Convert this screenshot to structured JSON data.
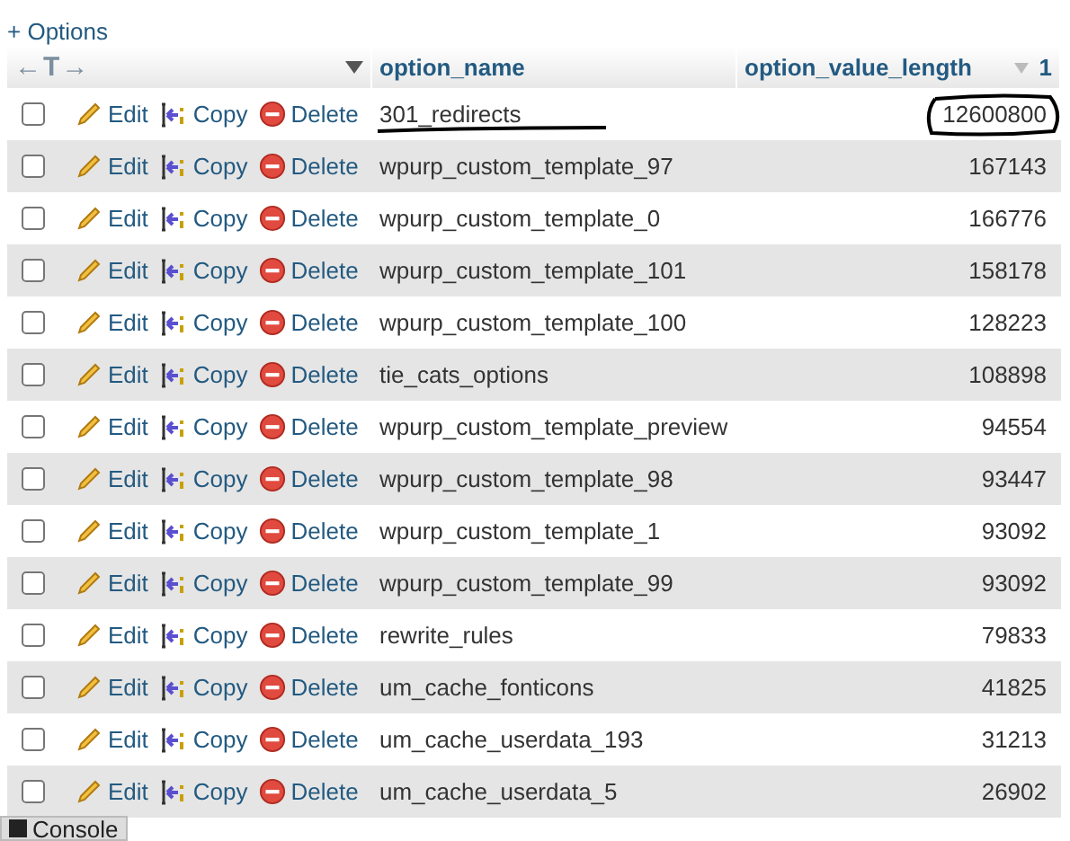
{
  "options_link": "+ Options",
  "header": {
    "arrows": "←T→",
    "columns": [
      {
        "label": "option_name"
      },
      {
        "label": "option_value_length",
        "sort_order": "1"
      }
    ]
  },
  "rows": [
    {
      "edit": "Edit",
      "copy": "Copy",
      "delete": "Delete",
      "name": "301_redirects",
      "length": "12600800",
      "checked": false,
      "marked": true
    },
    {
      "edit": "Edit",
      "copy": "Copy",
      "delete": "Delete",
      "name": "wpurp_custom_template_97",
      "length": "167143",
      "checked": false,
      "marked": false
    },
    {
      "edit": "Edit",
      "copy": "Copy",
      "delete": "Delete",
      "name": "wpurp_custom_template_0",
      "length": "166776",
      "checked": false,
      "marked": false
    },
    {
      "edit": "Edit",
      "copy": "Copy",
      "delete": "Delete",
      "name": "wpurp_custom_template_101",
      "length": "158178",
      "checked": false,
      "marked": false
    },
    {
      "edit": "Edit",
      "copy": "Copy",
      "delete": "Delete",
      "name": "wpurp_custom_template_100",
      "length": "128223",
      "checked": false,
      "marked": false
    },
    {
      "edit": "Edit",
      "copy": "Copy",
      "delete": "Delete",
      "name": "tie_cats_options",
      "length": "108898",
      "checked": false,
      "marked": false
    },
    {
      "edit": "Edit",
      "copy": "Copy",
      "delete": "Delete",
      "name": "wpurp_custom_template_preview",
      "length": "94554",
      "checked": false,
      "marked": false
    },
    {
      "edit": "Edit",
      "copy": "Copy",
      "delete": "Delete",
      "name": "wpurp_custom_template_98",
      "length": "93447",
      "checked": false,
      "marked": false
    },
    {
      "edit": "Edit",
      "copy": "Copy",
      "delete": "Delete",
      "name": "wpurp_custom_template_1",
      "length": "93092",
      "checked": false,
      "marked": false
    },
    {
      "edit": "Edit",
      "copy": "Copy",
      "delete": "Delete",
      "name": "wpurp_custom_template_99",
      "length": "93092",
      "checked": false,
      "marked": false
    },
    {
      "edit": "Edit",
      "copy": "Copy",
      "delete": "Delete",
      "name": "rewrite_rules",
      "length": "79833",
      "checked": false,
      "marked": false
    },
    {
      "edit": "Edit",
      "copy": "Copy",
      "delete": "Delete",
      "name": "um_cache_fonticons",
      "length": "41825",
      "checked": false,
      "marked": false
    },
    {
      "edit": "Edit",
      "copy": "Copy",
      "delete": "Delete",
      "name": "um_cache_userdata_193",
      "length": "31213",
      "checked": false,
      "marked": false
    },
    {
      "edit": "Edit",
      "copy": "Copy",
      "delete": "Delete",
      "name": "um_cache_userdata_5",
      "length": "26902",
      "checked": false,
      "marked": false
    }
  ],
  "console_button": "Console"
}
